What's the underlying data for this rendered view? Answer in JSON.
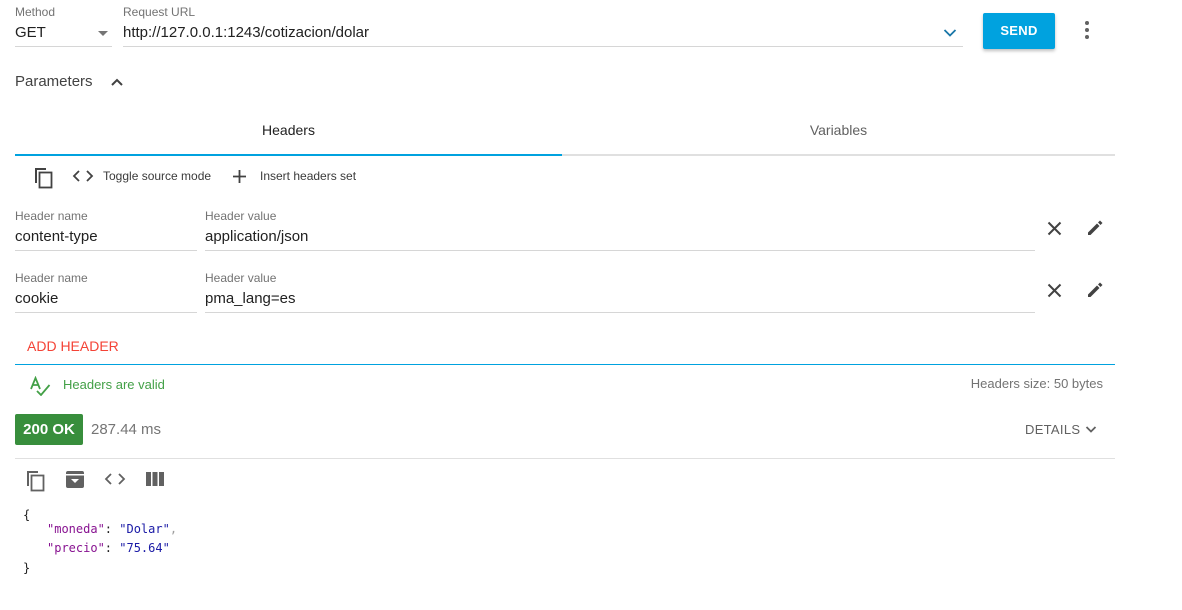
{
  "request": {
    "method_label": "Method",
    "method_value": "GET",
    "url_label": "Request URL",
    "url_value": "http://127.0.0.1:1243/cotizacion/dolar",
    "send_label": "SEND"
  },
  "parameters": {
    "title": "Parameters"
  },
  "tabs": [
    {
      "label": "Headers",
      "active": true
    },
    {
      "label": "Variables",
      "active": false
    }
  ],
  "toolbar": {
    "toggle_source": "Toggle source mode",
    "insert_set": "Insert headers set"
  },
  "headers": [
    {
      "name_label": "Header name",
      "name": "content-type",
      "value_label": "Header value",
      "value": "application/json"
    },
    {
      "name_label": "Header name",
      "name": "cookie",
      "value_label": "Header value",
      "value": "pma_lang=es"
    }
  ],
  "add_header": "ADD HEADER",
  "validation": {
    "status": "Headers are valid",
    "size": "Headers size: 50 bytes"
  },
  "response": {
    "status": "200 OK",
    "time": "287.44 ms",
    "details": "DETAILS",
    "json": {
      "open": "{",
      "key1": "\"moneda\"",
      "val1": "\"Dolar\"",
      "key2": "\"precio\"",
      "val2": "\"75.64\"",
      "close": "}"
    }
  },
  "colors": {
    "accent": "#00a2df",
    "error": "#f44336",
    "valid": "#43a047",
    "status_ok": "#388e3c"
  },
  "icons": [
    "chevron-down-icon",
    "more-vert-icon",
    "chevron-up-icon",
    "copy-icon",
    "code-icon",
    "plus-icon",
    "close-icon",
    "edit-icon",
    "spellcheck-icon",
    "archive-icon",
    "columns-icon"
  ]
}
